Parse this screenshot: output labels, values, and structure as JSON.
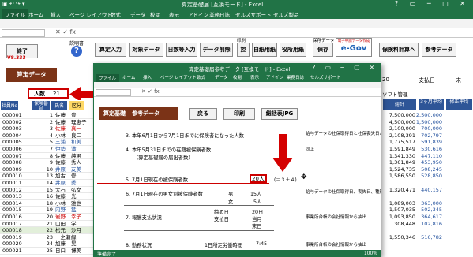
{
  "excel": {
    "title": "算定基礎届 [互換モード] - Excel",
    "tabs": [
      "ファイル",
      "ホーム",
      "挿入",
      "ページ レイアウト",
      "数式",
      "データ",
      "校閲",
      "表示",
      "アドイン",
      "業務日誌",
      "セルズサポート",
      "セルズ製品"
    ]
  },
  "toolbar": {
    "end": "終了",
    "help_label": "説明書",
    "calc_input": "算定入力",
    "target_data": "対象データ",
    "daily_input": "日数等入力",
    "data_delete": "データ削除",
    "print_group": "印刷",
    "print_btn": "控",
    "self_form": "自紙用紙",
    "official_form": "役所用紙",
    "save_group": "保存データ",
    "save_btn": "保存",
    "egov_caption": "電子申請データ作成",
    "egov": "e-Gov",
    "insurance_calc": "保険料計算へ",
    "ref_data": "参考データ"
  },
  "version": "V8.333",
  "santei_data": "算定データ",
  "ninzu": {
    "label": "人数",
    "value": "21"
  },
  "col_headers": {
    "shain_no": "社員No",
    "hoken_no": "保険番号",
    "name": "氏名",
    "kubun": "区分"
  },
  "right_headers": {
    "soft_kan": "ソフト管理",
    "num20": "20",
    "shiharai": "支払日",
    "matsu": "末",
    "total": "総計",
    "avg": "3ヶ月平均",
    "fix": "修正平均"
  },
  "rows": [
    {
      "no": "000001",
      "hn": "1",
      "sei": "佐藤",
      "mei": "豊",
      "color": ""
    },
    {
      "no": "000002",
      "hn": "2",
      "sei": "佐藤",
      "mei": "理恵子",
      "color": ""
    },
    {
      "no": "000003",
      "hn": "3",
      "sei": "佐藤",
      "mei": "真一",
      "color": "red"
    },
    {
      "no": "000004",
      "hn": "4",
      "sei": "小林",
      "mei": "良二",
      "color": ""
    },
    {
      "no": "000005",
      "hn": "5",
      "sei": "三浦",
      "mei": "和美",
      "color": "blue"
    },
    {
      "no": "000006",
      "hn": "7",
      "sei": "伊勢",
      "mei": "満",
      "color": "blue"
    },
    {
      "no": "000007",
      "hn": "8",
      "sei": "佐藤",
      "mei": "純男",
      "color": ""
    },
    {
      "no": "000008",
      "hn": "9",
      "sei": "佐藤",
      "mei": "秀人",
      "color": ""
    },
    {
      "no": "000009",
      "hn": "10",
      "sei": "井原",
      "mei": "友美",
      "color": "blue"
    },
    {
      "no": "000010",
      "hn": "13",
      "sei": "加古",
      "mei": "修",
      "color": ""
    },
    {
      "no": "000011",
      "hn": "14",
      "sei": "井原",
      "mei": "秀",
      "color": "blue"
    },
    {
      "no": "000012",
      "hn": "15",
      "sei": "大石",
      "mei": "弘文",
      "color": ""
    },
    {
      "no": "000013",
      "hn": "16",
      "sei": "佐藤",
      "mei": "光",
      "color": ""
    },
    {
      "no": "000014",
      "hn": "18",
      "sei": "小林",
      "mei": "雅也",
      "color": ""
    },
    {
      "no": "000015",
      "hn": "19",
      "sei": "内野",
      "mei": "猛",
      "color": "blue"
    },
    {
      "no": "000016",
      "hn": "20",
      "sei": "岩野",
      "mei": "幸子",
      "color": "red"
    },
    {
      "no": "000017",
      "hn": "21",
      "sei": "山田",
      "mei": "学",
      "color": ""
    },
    {
      "no": "000018",
      "hn": "22",
      "sei": "松元",
      "mei": "沙月",
      "color": "green"
    },
    {
      "no": "000019",
      "hn": "23",
      "sei": "一之瀬",
      "mei": "緑",
      "color": ""
    },
    {
      "no": "000020",
      "hn": "24",
      "sei": "加藤",
      "mei": "晃",
      "color": ""
    },
    {
      "no": "000021",
      "hn": "25",
      "sei": "日口",
      "mei": "博美",
      "color": ""
    }
  ],
  "right_values": [
    {
      "total": "7,500,000",
      "avg": "2,500,000"
    },
    {
      "total": "4,500,000",
      "avg": "1,500,000"
    },
    {
      "total": "2,100,000",
      "avg": "700,000"
    },
    {
      "total": "2,108,391",
      "avg": "702,797"
    },
    {
      "total": "1,775,517",
      "avg": "591,839"
    },
    {
      "total": "1,591,849",
      "avg": "530,616"
    },
    {
      "total": "1,341,330",
      "avg": "447,110"
    },
    {
      "total": "1,361,849",
      "avg": "453,950"
    },
    {
      "total": "1,524,735",
      "avg": "508,245"
    },
    {
      "total": "1,586,550",
      "avg": "528,850"
    },
    {
      "total": "",
      "avg": ""
    },
    {
      "total": "1,320,471",
      "avg": "440,157"
    },
    {
      "total": "",
      "avg": ""
    },
    {
      "total": "1,089,003",
      "avg": "363,000"
    },
    {
      "total": "1,507,035",
      "avg": "502,345"
    },
    {
      "total": "1,093,850",
      "avg": "364,617"
    },
    {
      "total": "308,448",
      "avg": "102,816"
    },
    {
      "total": "",
      "avg": ""
    },
    {
      "total": "1,550,346",
      "avg": "516,782"
    }
  ],
  "popup": {
    "title": "算定基礎届参考データ [互換モード] - Excel",
    "tabs": [
      "ファイル",
      "ホーム",
      "挿入",
      "ページ レイアウト",
      "数式",
      "データ",
      "校閲",
      "表示",
      "アドイン",
      "業務日誌",
      "セルズサポート"
    ],
    "title_btn": "算定基礎",
    "title_btn2": "参考データ",
    "back": "戻る",
    "print": "印刷",
    "jpg": "総括表JPG",
    "lines": [
      {
        "n": "3. 本年6月1日から7月1日までに保険者になった人数",
        "note": "給与データの社保取得日と社保喪失日から抽出"
      },
      {
        "n": "4. 本年5月31日までの在籍被保険者数",
        "sub": "（算定基礎届の届出者数）",
        "note": "同上"
      },
      {
        "n": "5. 7月1日現在の被保険者数",
        "val": "20人",
        "note": "(＝３＋４)"
      },
      {
        "n": "6. 7月1日現在の男女別被保険者数",
        "m": "男",
        "mv": "15人",
        "f": "女",
        "fv": "5人",
        "note": "給与データの社保取得日、喪失日、種別から抽出"
      },
      {
        "n": "7. 報酬支払状況",
        "a": "締め日",
        "av": "20日",
        "b": "支払日",
        "bv": "当月",
        "c": "末日",
        "note": "事業所台帳の会社情報から抽出"
      },
      {
        "n": "8. 勤務状況",
        "a": "1日所定労働時間",
        "av": "7:45",
        "note": "事業所台帳の会社情報から抽出"
      }
    ],
    "status": "準備完了",
    "zoom": "100%"
  }
}
